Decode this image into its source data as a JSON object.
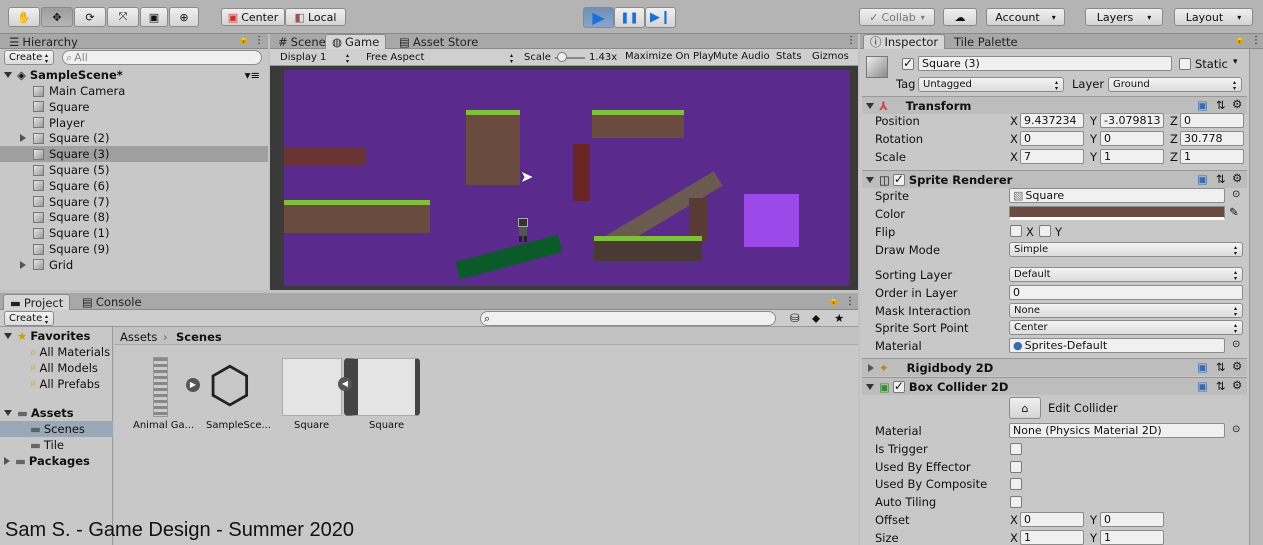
{
  "toolbar": {
    "center_label": "Center",
    "local_label": "Local",
    "collab_label": "Collab",
    "account_label": "Account",
    "layers_label": "Layers",
    "layout_label": "Layout"
  },
  "hierarchy": {
    "tab_label": "Hierarchy",
    "create_label": "Create",
    "search_placeholder": "All",
    "scene_name": "SampleScene*",
    "items": [
      {
        "label": "Main Camera",
        "expandable": false,
        "selected": false
      },
      {
        "label": "Square",
        "expandable": false,
        "selected": false
      },
      {
        "label": "Player",
        "expandable": false,
        "selected": false
      },
      {
        "label": "Square (2)",
        "expandable": true,
        "selected": false
      },
      {
        "label": "Square (3)",
        "expandable": false,
        "selected": true
      },
      {
        "label": "Square (5)",
        "expandable": false,
        "selected": false
      },
      {
        "label": "Square (6)",
        "expandable": false,
        "selected": false
      },
      {
        "label": "Square (7)",
        "expandable": false,
        "selected": false
      },
      {
        "label": "Square (8)",
        "expandable": false,
        "selected": false
      },
      {
        "label": "Square (1)",
        "expandable": false,
        "selected": false
      },
      {
        "label": "Square (9)",
        "expandable": false,
        "selected": false
      },
      {
        "label": "Grid",
        "expandable": true,
        "selected": false
      }
    ]
  },
  "game_view": {
    "tabs": [
      "Scene",
      "Game",
      "Asset Store"
    ],
    "display_label": "Display 1",
    "aspect_label": "Free Aspect",
    "scale_label": "Scale",
    "scale_value": "1.43x",
    "maximize_label": "Maximize On Play",
    "mute_label": "Mute Audio",
    "stats_label": "Stats",
    "gizmos_label": "Gizmos",
    "background_color": "#5a2a8c"
  },
  "project": {
    "tabs": [
      "Project",
      "Console"
    ],
    "create_label": "Create",
    "favorites_label": "Favorites",
    "favorites": [
      "All Materials",
      "All Models",
      "All Prefabs"
    ],
    "assets_label": "Assets",
    "asset_folders": [
      "Scenes",
      "Tile"
    ],
    "packages_label": "Packages",
    "breadcrumb": [
      "Assets",
      "Scenes"
    ],
    "items": [
      "Animal Ga...",
      "SampleSce...",
      "Square",
      "Square"
    ]
  },
  "inspector": {
    "tabs": [
      "Inspector",
      "Tile Palette"
    ],
    "object_name": "Square (3)",
    "static_label": "Static",
    "tag_label": "Tag",
    "tag_value": "Untagged",
    "layer_label": "Layer",
    "layer_value": "Ground",
    "transform": {
      "title": "Transform",
      "position_label": "Position",
      "position": {
        "x": "9.437234",
        "y": "-3.079813",
        "z": "0"
      },
      "rotation_label": "Rotation",
      "rotation": {
        "x": "0",
        "y": "0",
        "z": "30.778"
      },
      "scale_label": "Scale",
      "scale": {
        "x": "7",
        "y": "1",
        "z": "1"
      }
    },
    "sprite_renderer": {
      "title": "Sprite Renderer",
      "sprite_label": "Sprite",
      "sprite_value": "Square",
      "color_label": "Color",
      "color_value": "#6b4a40",
      "flip_label": "Flip",
      "flip_x": "X",
      "flip_y": "Y",
      "draw_mode_label": "Draw Mode",
      "draw_mode_value": "Simple",
      "sorting_layer_label": "Sorting Layer",
      "sorting_layer_value": "Default",
      "order_label": "Order in Layer",
      "order_value": "0",
      "mask_label": "Mask Interaction",
      "mask_value": "None",
      "sort_point_label": "Sprite Sort Point",
      "sort_point_value": "Center",
      "material_label": "Material",
      "material_value": "Sprites-Default"
    },
    "rigidbody": {
      "title": "Rigidbody 2D"
    },
    "box_collider": {
      "title": "Box Collider 2D",
      "edit_label": "Edit Collider",
      "material_label": "Material",
      "material_value": "None (Physics Material 2D)",
      "is_trigger_label": "Is Trigger",
      "used_by_effector_label": "Used By Effector",
      "used_by_composite_label": "Used By Composite",
      "auto_tiling_label": "Auto Tiling",
      "offset_label": "Offset",
      "offset": {
        "x": "0",
        "y": "0"
      },
      "size_label": "Size",
      "size": {
        "x": "1",
        "y": "1"
      }
    },
    "axis_x": "X",
    "axis_y": "Y",
    "axis_z": "Z"
  },
  "watermark": "Sam S. - Game Design - Summer 2020"
}
